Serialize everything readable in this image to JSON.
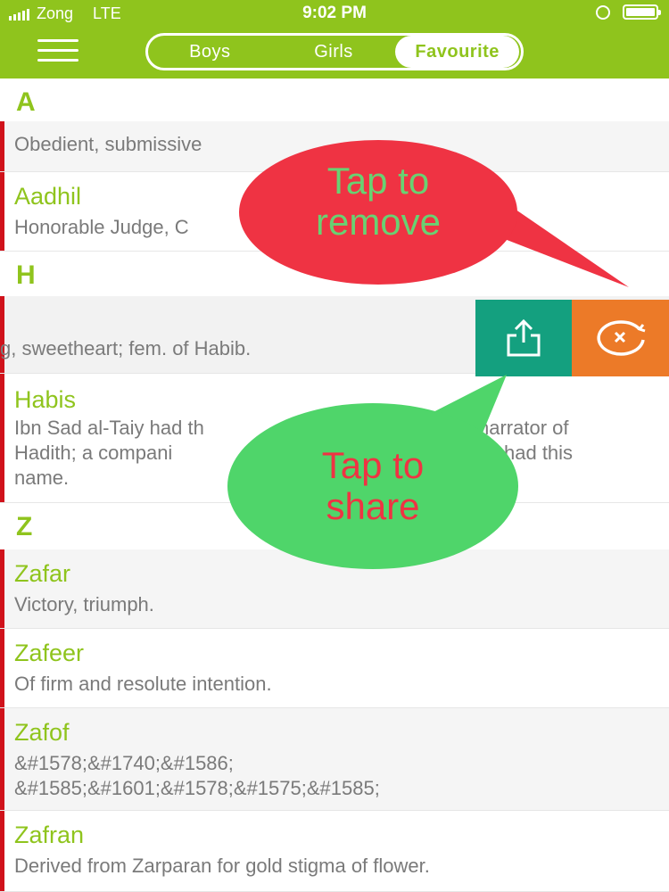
{
  "status_bar": {
    "carrier": "Zong",
    "network": "LTE",
    "time": "9:02 PM"
  },
  "tabs": [
    {
      "label": "Boys",
      "active": false
    },
    {
      "label": "Girls",
      "active": false
    },
    {
      "label": "Favourite",
      "active": true
    }
  ],
  "sections": {
    "a": {
      "letter": "A"
    },
    "h": {
      "letter": "H"
    },
    "z": {
      "letter": "Z"
    }
  },
  "names": {
    "a1": {
      "meaning": "Obedient, submissive"
    },
    "a2": {
      "name": "Aadhil",
      "meaning": "Honorable Judge, C"
    },
    "h1": {
      "meaning": "g, sweetheart; fem. of Habib."
    },
    "h2": {
      "name": "Habis",
      "meaning_lines": [
        "Ibn Sad al-Taiy had th",
        "narrator of",
        "Hadith; a compani",
        "had this",
        "name."
      ]
    },
    "z1": {
      "name": "Zafar",
      "meaning": "Victory, triumph."
    },
    "z2": {
      "name": "Zafeer",
      "meaning": "Of firm and resolute intention."
    },
    "z3": {
      "name": "Zafof",
      "meaning_lines": [
        "&#1578;&#1740;&#1586;",
        "&#1585;&#1601;&#1578;&#1575;&#1585;"
      ]
    },
    "z4": {
      "name": "Zafran",
      "meaning": "Derived from Zarparan for gold stigma of flower."
    }
  },
  "callouts": {
    "remove": {
      "line1": "Tap to",
      "line2": "remove"
    },
    "share": {
      "line1": "Tap to",
      "line2": "share"
    }
  },
  "actions": {
    "share_icon": "share-icon",
    "remove_icon": "remove-icon"
  },
  "colors": {
    "primary": "#8fc41d",
    "marker": "#d0121b",
    "share": "#14a07f",
    "remove": "#ec7a28",
    "remove_callout": "#ef3343",
    "share_callout": "#4fd56a"
  }
}
